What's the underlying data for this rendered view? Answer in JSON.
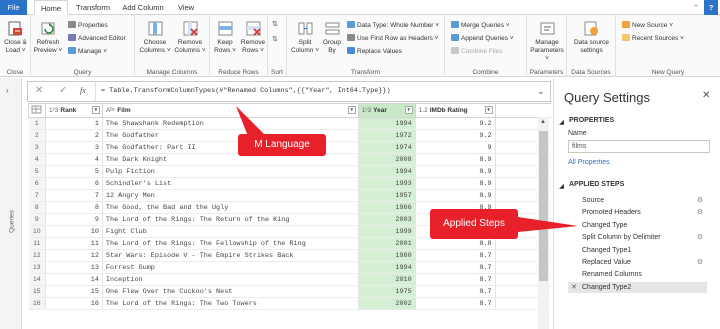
{
  "tabs": [
    "File",
    "Home",
    "Transform",
    "Add Column",
    "View"
  ],
  "ribbon": {
    "close_group": {
      "label": "Close",
      "close_load_line1": "Close &",
      "close_load_line2": "Load ˅"
    },
    "query_group": {
      "label": "Query",
      "refresh_line1": "Refresh",
      "refresh_line2": "Preview ˅",
      "properties": "Properties",
      "advanced_editor": "Advanced Editor",
      "manage": "Manage ˅"
    },
    "manage_columns_group": {
      "label": "Manage Columns",
      "choose_line1": "Choose",
      "choose_line2": "Columns ˅",
      "remove_line1": "Remove",
      "remove_line2": "Columns ˅"
    },
    "reduce_rows_group": {
      "label": "Reduce Rows",
      "keep_line1": "Keep",
      "keep_line2": "Rows ˅",
      "remove_line1": "Remove",
      "remove_line2": "Rows ˅"
    },
    "sort_group": {
      "label": "Sort"
    },
    "transform_group": {
      "label": "Transform",
      "split_line1": "Split",
      "split_line2": "Column ˅",
      "group_line1": "Group",
      "group_line2": "By",
      "data_type": "Data Type: Whole Number ˅",
      "first_row_headers": "Use First Row as Headers ˅",
      "replace_values": "Replace Values"
    },
    "combine_group": {
      "label": "Combine",
      "merge_queries": "Merge Queries ˅",
      "append_queries": "Append Queries ˅",
      "combine_files": "Combine Files"
    },
    "parameters_group": {
      "label": "Parameters",
      "manage_line1": "Manage",
      "manage_line2": "Parameters ˅"
    },
    "data_sources_group": {
      "label": "Data Sources",
      "ds_line1": "Data source",
      "ds_line2": "settings"
    },
    "new_query_group": {
      "label": "New Query",
      "new_source": "New Source ˅",
      "recent_sources": "Recent Sources ˅"
    }
  },
  "sidebar_label": "Queries",
  "formula_bar": {
    "fx": "fx",
    "formula": "= Table.TransformColumnTypes(#\"Renamed Columns\",{{\"Year\", Int64.Type}})"
  },
  "columns": [
    {
      "type_icon": "1²3",
      "name": "Rank"
    },
    {
      "type_icon": "Aᴮᶜ",
      "name": "Film"
    },
    {
      "type_icon": "1²3",
      "name": "Year"
    },
    {
      "type_icon": "1.2",
      "name": "IMDb Rating"
    }
  ],
  "rows": [
    {
      "n": "1",
      "rank": "1",
      "film": "The Shawshank Redemption",
      "year": "1994",
      "rating": "9.2"
    },
    {
      "n": "2",
      "rank": "2",
      "film": "The Godfather",
      "year": "1972",
      "rating": "9.2"
    },
    {
      "n": "3",
      "rank": "3",
      "film": "The Godfather: Part II",
      "year": "1974",
      "rating": "9"
    },
    {
      "n": "4",
      "rank": "4",
      "film": "The Dark Knight",
      "year": "2008",
      "rating": "8.9"
    },
    {
      "n": "5",
      "rank": "5",
      "film": "Pulp Fiction",
      "year": "1994",
      "rating": "8.9"
    },
    {
      "n": "6",
      "rank": "6",
      "film": "Schindler's List",
      "year": "1993",
      "rating": "8.9"
    },
    {
      "n": "7",
      "rank": "7",
      "film": "12 Angry Men",
      "year": "1957",
      "rating": "8.9"
    },
    {
      "n": "8",
      "rank": "8",
      "film": "The Good, the Bad and the Ugly",
      "year": "1966",
      "rating": "8.9"
    },
    {
      "n": "9",
      "rank": "9",
      "film": "The Lord of the Rings: The Return of the King",
      "year": "2003",
      "rating": "8.9"
    },
    {
      "n": "10",
      "rank": "10",
      "film": "Fight Club",
      "year": "1999",
      "rating": "8.8"
    },
    {
      "n": "11",
      "rank": "11",
      "film": "The Lord of the Rings: The Fellowship of the Ring",
      "year": "2001",
      "rating": "8.8"
    },
    {
      "n": "12",
      "rank": "12",
      "film": "Star Wars: Episode V - The Empire Strikes Back",
      "year": "1980",
      "rating": "8.7"
    },
    {
      "n": "13",
      "rank": "13",
      "film": "Forrest Gump",
      "year": "1994",
      "rating": "8.7"
    },
    {
      "n": "14",
      "rank": "14",
      "film": "Inception",
      "year": "2010",
      "rating": "8.7"
    },
    {
      "n": "15",
      "rank": "15",
      "film": "One Flew Over the Cuckoo's Nest",
      "year": "1975",
      "rating": "8.7"
    },
    {
      "n": "16",
      "rank": "16",
      "film": "The Lord of the Rings: The Two Towers",
      "year": "2002",
      "rating": "8.7"
    }
  ],
  "query_settings": {
    "title": "Query Settings",
    "properties_heading": "PROPERTIES",
    "name_label": "Name",
    "name_value": "films",
    "all_properties": "All Properties",
    "applied_steps_heading": "APPLIED STEPS",
    "steps": [
      {
        "label": "Source",
        "gear": "⚙"
      },
      {
        "label": "Promoted Headers",
        "gear": "⚙"
      },
      {
        "label": "Changed Type",
        "gear": ""
      },
      {
        "label": "Split Column by Delimiter",
        "gear": "⚙"
      },
      {
        "label": "Changed Type1",
        "gear": ""
      },
      {
        "label": "Replaced Value",
        "gear": "⚙"
      },
      {
        "label": "Renamed Columns",
        "gear": ""
      },
      {
        "label": "Changed Type2",
        "gear": ""
      }
    ]
  },
  "callouts": {
    "m_language": "M Language",
    "applied_steps": "Applied Steps"
  },
  "colors": {
    "file_tab": "#2b73c9",
    "callout": "#e8202a",
    "selected_column": "#d5efd4",
    "current_step": "#e6e6e6"
  }
}
